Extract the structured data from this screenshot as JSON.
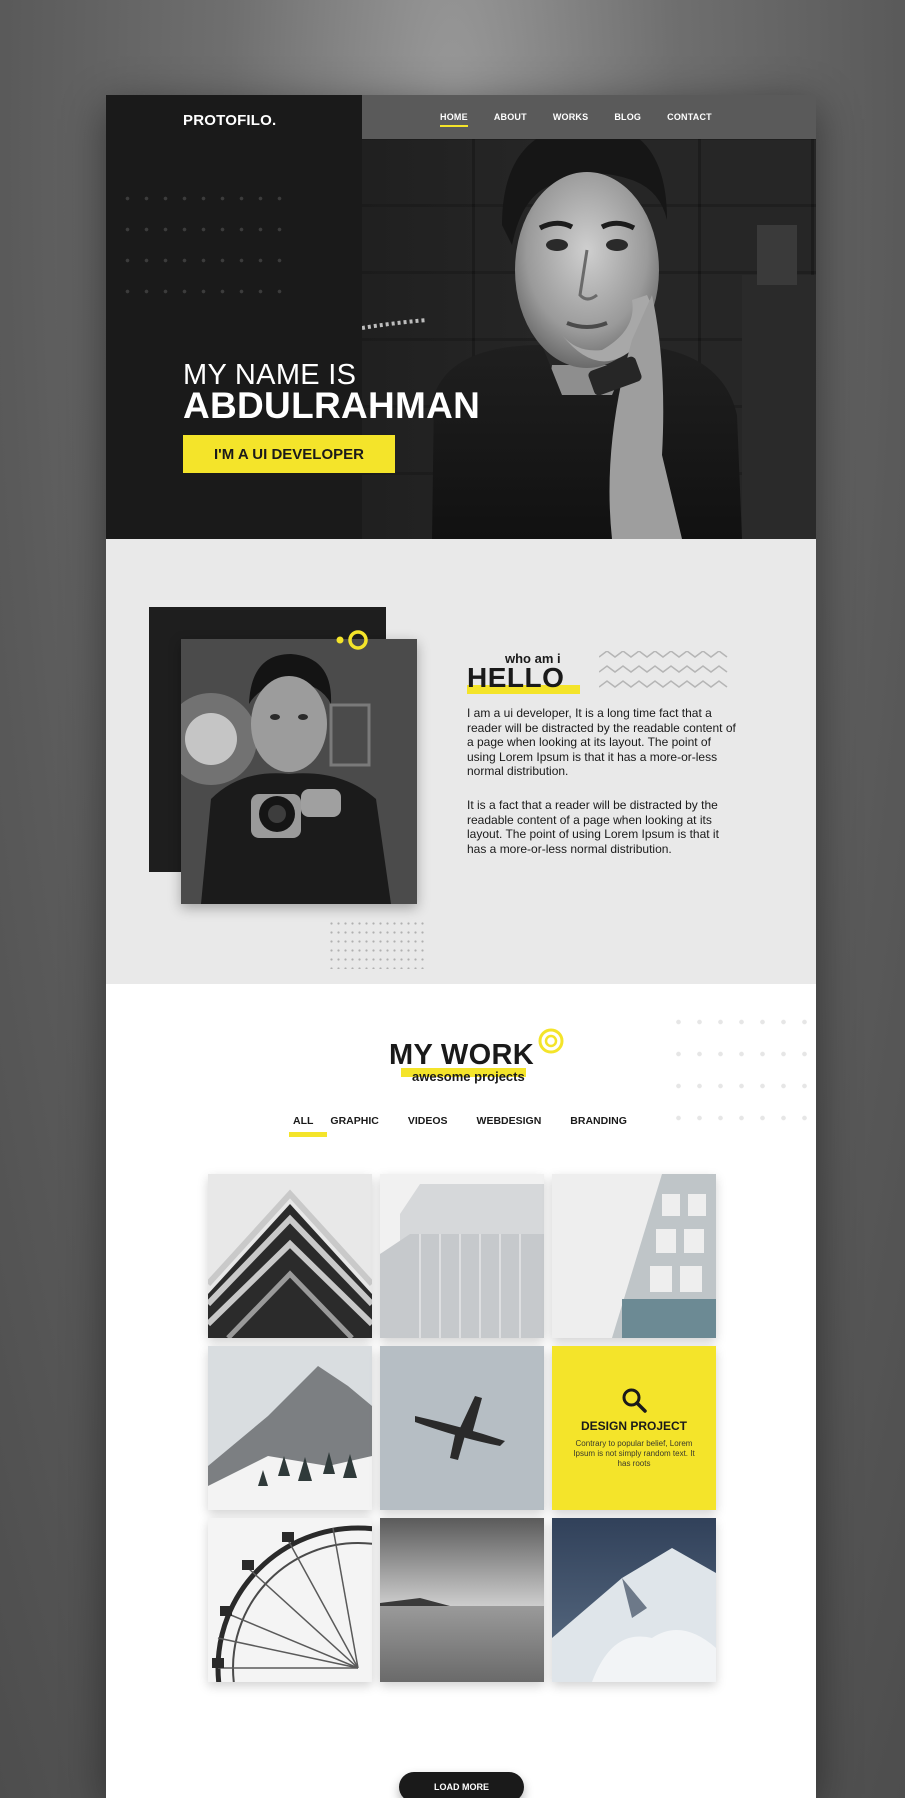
{
  "brand": {
    "logo": "PROTOFILO.",
    "accent": "#f4e42a",
    "dark": "#1a1a1a"
  },
  "nav": {
    "items": [
      {
        "label": "HOME",
        "active": true
      },
      {
        "label": "ABOUT",
        "active": false
      },
      {
        "label": "WORKS",
        "active": false
      },
      {
        "label": "BLOG",
        "active": false
      },
      {
        "label": "CONTACT",
        "active": false
      }
    ]
  },
  "hero": {
    "line1": "MY NAME IS",
    "line2": "ABDULRAHMAN",
    "badge": "I'M A UI DEVELOPER"
  },
  "about": {
    "eyebrow": "who am i",
    "heading": "HELLO",
    "paragraph1": "I am a ui developer, It is a long time fact that a reader will be distracted by the readable content of a page when looking at its layout. The point of using Lorem Ipsum is that it has a more-or-less normal distribution.",
    "paragraph2": "It is a fact that a reader will be distracted by the readable content of a page when looking at its layout. The point of using Lorem Ipsum is that it has a more-or-less normal distribution."
  },
  "work": {
    "heading": "MY WORK",
    "subheading": "awesome projects",
    "filters": [
      {
        "label": "ALL",
        "active": true
      },
      {
        "label": "GRAPHIC",
        "active": false
      },
      {
        "label": "VIDEOS",
        "active": false
      },
      {
        "label": "WEBDESIGN",
        "active": false
      },
      {
        "label": "BRANDING",
        "active": false
      }
    ],
    "featured": {
      "icon": "search-icon",
      "title": "DESIGN PROJECT",
      "description": "Contrary to popular belief, Lorem Ipsum is not simply random text. It has roots"
    },
    "load_more": "LOAD MORE"
  }
}
